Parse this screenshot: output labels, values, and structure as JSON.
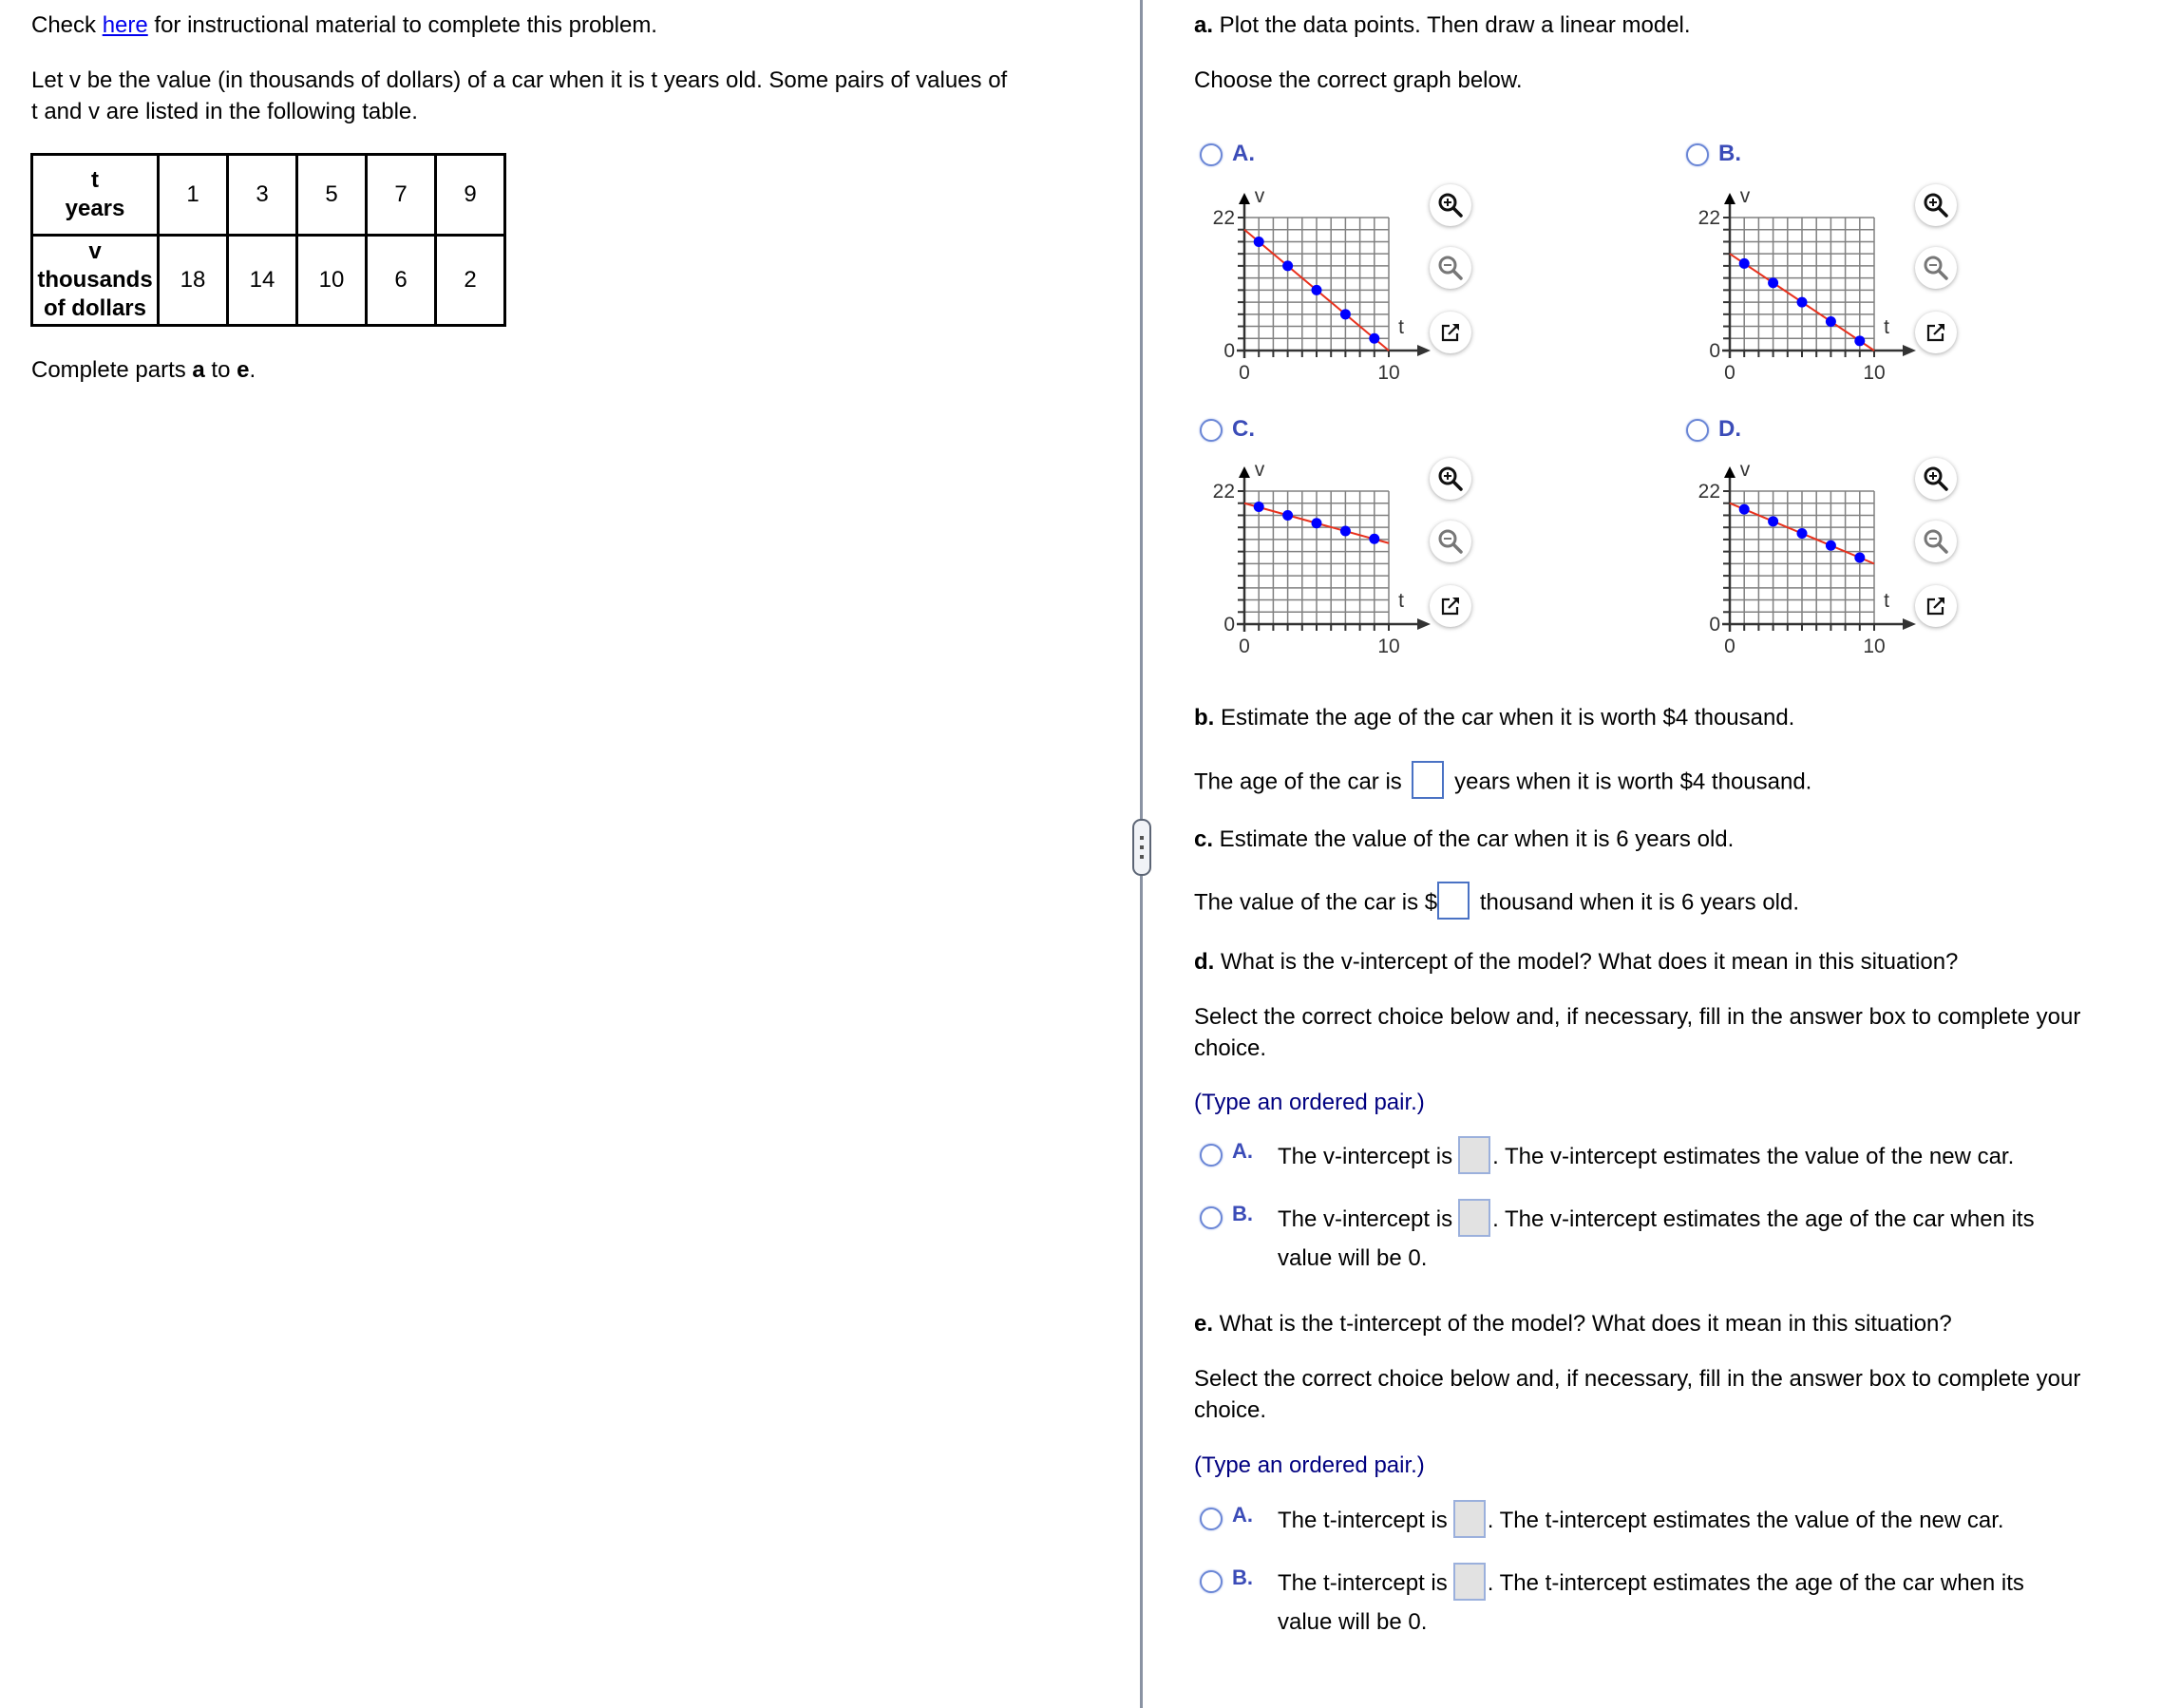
{
  "intro": {
    "check_prefix": "Check ",
    "check_link": "here",
    "check_suffix": " for instructional material to complete this problem.",
    "problem_line1": "Let v be the value (in thousands of dollars) of a car when it is t years old. Some pairs of values of",
    "problem_line2": "t and v are listed in the following table.",
    "complete_prefix": "Complete parts ",
    "complete_a": "a",
    "complete_mid": " to ",
    "complete_e": "e",
    "complete_suffix": "."
  },
  "table": {
    "row1_header": [
      "t",
      "years"
    ],
    "row2_header": [
      "v",
      "thousands",
      "of dollars"
    ],
    "t_values": [
      "1",
      "3",
      "5",
      "7",
      "9"
    ],
    "v_values": [
      "18",
      "14",
      "10",
      "6",
      "2"
    ]
  },
  "part_a": {
    "prompt_bold": "a.",
    "prompt": " Plot the data points. Then draw a linear model.",
    "instruction": "Choose the correct graph below."
  },
  "chart_data": [
    {
      "type": "scatter",
      "option": "A.",
      "xlabel": "t",
      "ylabel": "v",
      "xlim": [
        0,
        10
      ],
      "ylim": [
        0,
        22
      ],
      "x_ticks_labeled": [
        "0",
        "10"
      ],
      "y_ticks_labeled": [
        "0",
        "22"
      ],
      "grid": true,
      "x_grid_step": 1,
      "y_grid_step": 2,
      "points": [
        [
          1,
          18
        ],
        [
          3,
          14
        ],
        [
          5,
          10
        ],
        [
          7,
          6
        ],
        [
          9,
          2
        ]
      ],
      "line": [
        [
          0,
          20
        ],
        [
          10,
          0
        ]
      ]
    },
    {
      "type": "scatter",
      "option": "B.",
      "xlabel": "t",
      "ylabel": "v",
      "xlim": [
        0,
        10
      ],
      "ylim": [
        0,
        22
      ],
      "x_ticks_labeled": [
        "0",
        "10"
      ],
      "y_ticks_labeled": [
        "0",
        "22"
      ],
      "grid": true,
      "x_grid_step": 1,
      "y_grid_step": 2,
      "points": [
        [
          1,
          14.4
        ],
        [
          3,
          11.2
        ],
        [
          5,
          8
        ],
        [
          7,
          4.8
        ],
        [
          9,
          1.6
        ]
      ],
      "line": [
        [
          0,
          16
        ],
        [
          10,
          0
        ]
      ]
    },
    {
      "type": "scatter",
      "option": "C.",
      "xlabel": "t",
      "ylabel": "v",
      "xlim": [
        0,
        10
      ],
      "ylim": [
        0,
        22
      ],
      "x_ticks_labeled": [
        "0",
        "10"
      ],
      "y_ticks_labeled": [
        "0",
        "22"
      ],
      "grid": true,
      "x_grid_step": 1,
      "y_grid_step": 2,
      "points": [
        [
          1,
          19.4
        ],
        [
          3,
          18
        ],
        [
          5,
          16.7
        ],
        [
          7,
          15.4
        ],
        [
          9,
          14.1
        ]
      ],
      "line": [
        [
          0,
          20
        ],
        [
          10,
          13.4
        ]
      ]
    },
    {
      "type": "scatter",
      "option": "D.",
      "xlabel": "t",
      "ylabel": "v",
      "xlim": [
        0,
        10
      ],
      "ylim": [
        0,
        22
      ],
      "x_ticks_labeled": [
        "0",
        "10"
      ],
      "y_ticks_labeled": [
        "0",
        "22"
      ],
      "grid": true,
      "x_grid_step": 1,
      "y_grid_step": 2,
      "points": [
        [
          1,
          19
        ],
        [
          3,
          17
        ],
        [
          5,
          15
        ],
        [
          7,
          13
        ],
        [
          9,
          11
        ]
      ],
      "line": [
        [
          0,
          20
        ],
        [
          10,
          10
        ]
      ]
    }
  ],
  "graph_colors": {
    "point": "#0000ff",
    "line": "#e8311d",
    "grid": "#808080",
    "axis": "#333333"
  },
  "graph_tools": [
    "zoom-in",
    "zoom-out",
    "pop-out"
  ],
  "part_b": {
    "prompt_bold": "b.",
    "prompt": " Estimate the age of the car when it is worth $4 thousand.",
    "answer_prefix": "The age of the car is",
    "answer_value": "",
    "answer_suffix": "years when it is worth $4 thousand."
  },
  "part_c": {
    "prompt_bold": "c.",
    "prompt": " Estimate the value of the car when it is 6 years old.",
    "answer_prefix": "The value of the car is $",
    "answer_value": "",
    "answer_suffix": "thousand when it is 6 years old."
  },
  "part_d": {
    "prompt_bold": "d.",
    "prompt": " What is the v-intercept of the model? What does it mean in this situation?",
    "instruction_line1": "Select the correct choice below and, if necessary, fill in the answer box to complete your",
    "instruction_line2": "choice.",
    "hint": "(Type an ordered pair.)",
    "options": [
      {
        "label": "A.",
        "prefix": "The v-intercept is",
        "suffix": ". The v-intercept estimates the value of the new car.",
        "line2": ""
      },
      {
        "label": "B.",
        "prefix": "The v-intercept is",
        "suffix": ". The v-intercept estimates the age of the car when its",
        "line2": "value will be 0."
      }
    ]
  },
  "part_e": {
    "prompt_bold": "e.",
    "prompt": " What is the t-intercept of the model? What does it mean in this situation?",
    "instruction_line1": "Select the correct choice below and, if necessary, fill in the answer box to complete your",
    "instruction_line2": "choice.",
    "hint": "(Type an ordered pair.)",
    "options": [
      {
        "label": "A.",
        "prefix": "The t-intercept is",
        "suffix": ". The t-intercept estimates the value of the new car.",
        "line2": ""
      },
      {
        "label": "B.",
        "prefix": "The t-intercept is",
        "suffix": ". The t-intercept estimates the age of the car when its",
        "line2": "value will be 0."
      }
    ]
  }
}
